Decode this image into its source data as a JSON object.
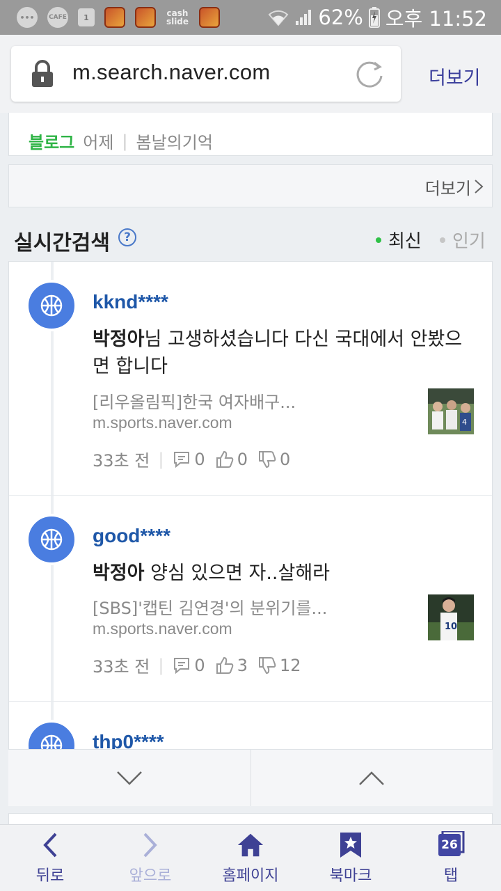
{
  "status_bar": {
    "cafe_label": "CAFE",
    "one_label": "1",
    "cash_label": "cash slide",
    "battery": "62%",
    "time": "오후 11:52"
  },
  "address_bar": {
    "url": "m.search.naver.com",
    "more_label": "더보기"
  },
  "blog": {
    "tag": "블로그",
    "date": "어제",
    "author": "봄날의기억"
  },
  "more_bar": {
    "label": "더보기"
  },
  "realtime": {
    "title": "실시간검색",
    "help": "?",
    "sort_latest": "최신",
    "sort_popular": "인기"
  },
  "feed": [
    {
      "user": "kknd****",
      "comment_bold": "박정아",
      "comment_rest": "님 고생하셨습니다 다신 국대에서 안봤으면 합니다",
      "news_title": "[리우올림픽]한국 여자배구...",
      "news_url": "m.sports.naver.com",
      "time": "33초 전",
      "replies": "0",
      "likes": "0",
      "dislikes": "0"
    },
    {
      "user": "good****",
      "comment_bold": "박정아",
      "comment_rest": " 양심 있으면 자..살해라",
      "news_title": "[SBS]'캡틴 김연경'의 분위기를...",
      "news_url": "m.sports.naver.com",
      "time": "33초 전",
      "replies": "0",
      "likes": "3",
      "dislikes": "12"
    },
    {
      "user": "thp0****"
    }
  ],
  "bottom_nav": {
    "back": "뒤로",
    "forward": "앞으로",
    "home": "홈페이지",
    "bookmark": "북마크",
    "tabs": "탭",
    "tab_count": "26"
  },
  "colors": {
    "accent": "#3e4194",
    "user_link": "#1e57a8",
    "blog_green": "#2fb446",
    "avatar_blue": "#4a7de0"
  }
}
